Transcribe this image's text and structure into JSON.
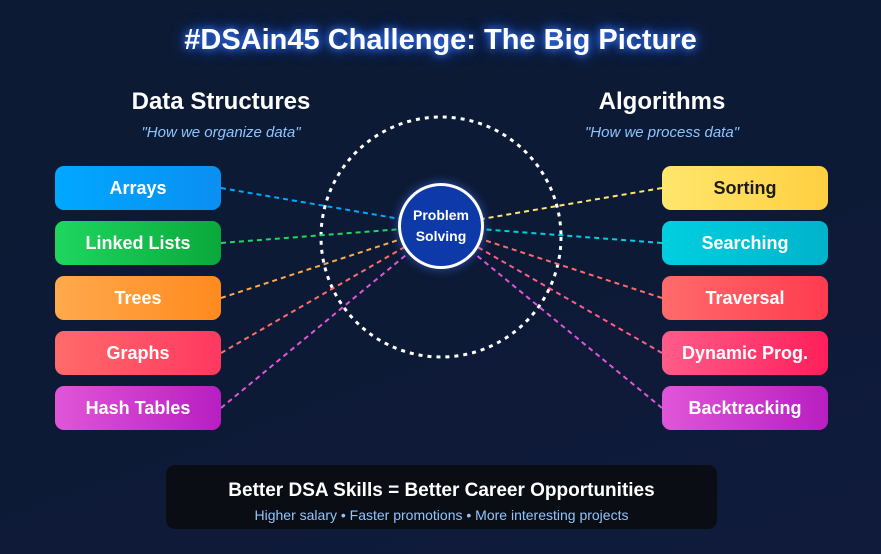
{
  "title": "#DSAin45 Challenge: The Big Picture",
  "data_structures": {
    "heading": "Data Structures",
    "subtitle": "\"How we organize data\"",
    "items": [
      {
        "label": "Arrays",
        "color": "#00a8ff",
        "color2": "#0a8ff2",
        "text": "#ffffff"
      },
      {
        "label": "Linked Lists",
        "color": "#1ed760",
        "color2": "#0aa83a",
        "text": "#ffffff"
      },
      {
        "label": "Trees",
        "color": "#ffa94d",
        "color2": "#ff8a1e",
        "text": "#ffffff"
      },
      {
        "label": "Graphs",
        "color": "#ff6b6b",
        "color2": "#ff3860",
        "text": "#ffffff"
      },
      {
        "label": "Hash Tables",
        "color": "#e056d8",
        "color2": "#b81ec2",
        "text": "#ffffff"
      }
    ]
  },
  "algorithms": {
    "heading": "Algorithms",
    "subtitle": "\"How we process data\"",
    "items": [
      {
        "label": "Sorting",
        "color": "#ffe66d",
        "color2": "#ffcf40",
        "text": "#1a1a1a"
      },
      {
        "label": "Searching",
        "color": "#00cfe0",
        "color2": "#00b3cc",
        "text": "#ffffff"
      },
      {
        "label": "Traversal",
        "color": "#ff6b6b",
        "color2": "#ff3b4f",
        "text": "#ffffff"
      },
      {
        "label": "Dynamic Prog.",
        "color": "#ff5c8a",
        "color2": "#ff1f5a",
        "text": "#ffffff"
      },
      {
        "label": "Backtracking",
        "color": "#e056d8",
        "color2": "#b81ec2",
        "text": "#ffffff"
      }
    ]
  },
  "center": {
    "line1": "Problem",
    "line2": "Solving",
    "hub_color": "#0d3aa8"
  },
  "footer": {
    "title": "Better DSA Skills = Better Career Opportunities",
    "subtitle": "Higher salary • Faster promotions • More interesting projects"
  }
}
